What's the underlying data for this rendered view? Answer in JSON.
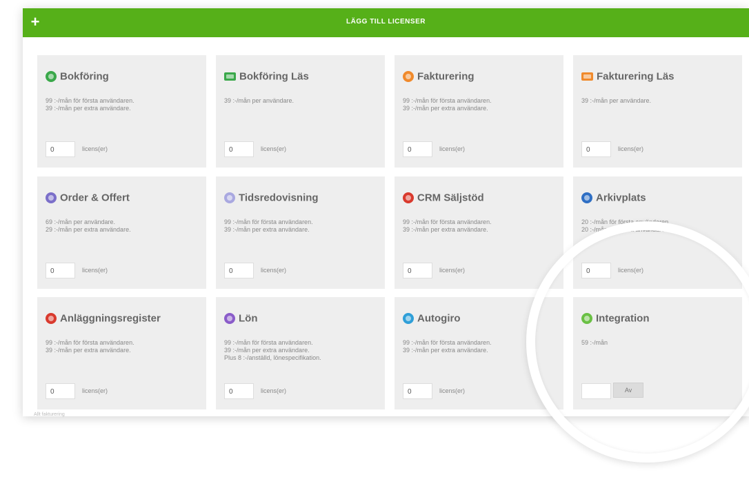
{
  "header": {
    "add_symbol": "+",
    "title": "LÄGG TILL LICENSER"
  },
  "colors": {
    "accent": "#56b019",
    "card_bg": "#eeeeee"
  },
  "cards": [
    {
      "title": "Bokföring",
      "icon": "bookkeeping-icon",
      "icon_color": "#3aa84a",
      "desc": [
        "99 :-/mån för första användaren.",
        "39 :-/mån per extra användare."
      ],
      "qty": "0",
      "unit": "licens(er)"
    },
    {
      "title": "Bokföring Läs",
      "icon": "bookkeeping-read-icon",
      "icon_color": "#3aa84a",
      "desc": [
        "39 :-/mån per användare."
      ],
      "qty": "0",
      "unit": "licens(er)"
    },
    {
      "title": "Fakturering",
      "icon": "invoicing-icon",
      "icon_color": "#f08a2c",
      "desc": [
        "99 :-/mån för första användaren.",
        "39 :-/mån per extra användare."
      ],
      "qty": "0",
      "unit": "licens(er)"
    },
    {
      "title": "Fakturering Läs",
      "icon": "invoicing-read-icon",
      "icon_color": "#f08a2c",
      "desc": [
        "39 :-/mån per användare."
      ],
      "qty": "0",
      "unit": "licens(er)"
    },
    {
      "title": "Order & Offert",
      "icon": "order-quote-icon",
      "icon_color": "#7b6fc9",
      "desc": [
        "69 :-/mån per användare.",
        "29 :-/mån per extra användare."
      ],
      "qty": "0",
      "unit": "licens(er)"
    },
    {
      "title": "Tidsredovisning",
      "icon": "time-reporting-icon",
      "icon_color": "#a9a8e0",
      "desc": [
        "99 :-/mån för första användaren.",
        "39 :-/mån per extra användare."
      ],
      "qty": "0",
      "unit": "licens(er)"
    },
    {
      "title": "CRM Säljstöd",
      "icon": "crm-icon",
      "icon_color": "#d93a2e",
      "desc": [
        "99 :-/mån för första användaren.",
        "39 :-/mån per extra användare."
      ],
      "qty": "0",
      "unit": "licens(er)"
    },
    {
      "title": "Arkivplats",
      "icon": "archive-icon",
      "icon_color": "#2f6fc4",
      "desc": [
        "20 :-/mån för första användaren.",
        "20 :-/mån per extra användare."
      ],
      "qty": "0",
      "unit": "licens(er)"
    },
    {
      "title": "Anläggningsregister",
      "icon": "asset-register-icon",
      "icon_color": "#d93a2e",
      "desc": [
        "99 :-/mån för första användaren.",
        "39 :-/mån per extra användare."
      ],
      "qty": "0",
      "unit": "licens(er)"
    },
    {
      "title": "Lön",
      "icon": "payroll-icon",
      "icon_color": "#8a5cc9",
      "desc": [
        "99 :-/mån för första användaren.",
        "39 :-/mån per extra användare.",
        "Plus 8 :-/anställd, lönespecifikation."
      ],
      "qty": "0",
      "unit": "licens(er)"
    },
    {
      "title": "Autogiro",
      "icon": "autogiro-icon",
      "icon_color": "#2f9fd8",
      "desc": [
        "99 :-/mån för första användaren.",
        "39 :-/mån per extra användare."
      ],
      "qty": "0",
      "unit": "licens(er)"
    },
    {
      "title": "Integration",
      "icon": "integration-icon",
      "icon_color": "#6ac044",
      "desc": [
        "59 :-/mån"
      ],
      "button": "Av"
    }
  ],
  "footer": {
    "text": "Allt fakturering"
  }
}
